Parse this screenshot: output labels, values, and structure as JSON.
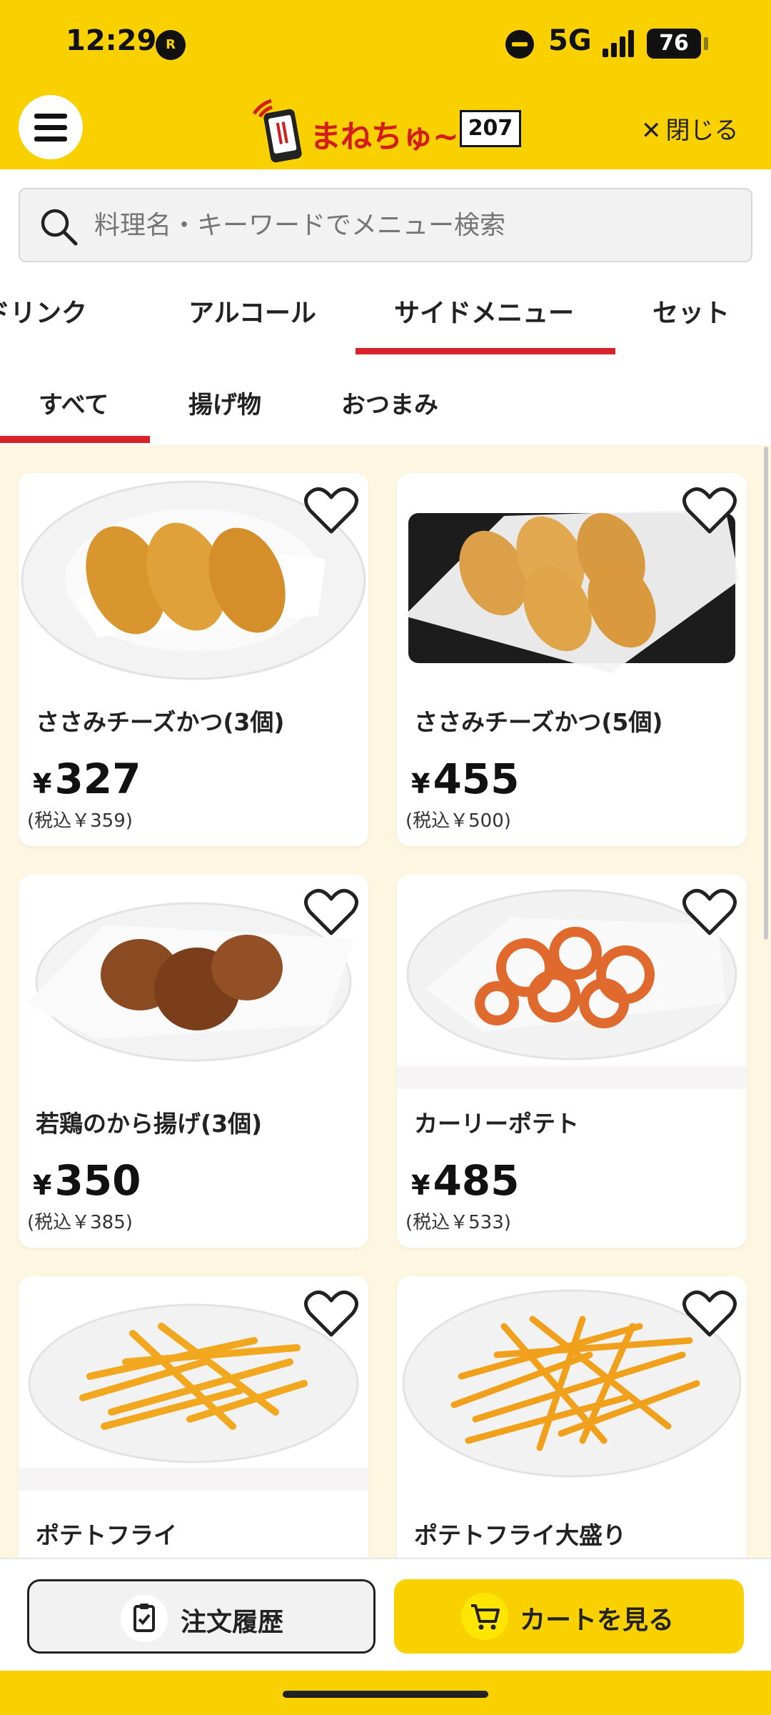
{
  "status_bar": {
    "time": "12:29",
    "r_badge": "R",
    "network": "5G",
    "battery": "76"
  },
  "header": {
    "logo_text": "まねちゅ~",
    "table_number": "207",
    "close_label": "閉じる"
  },
  "search": {
    "placeholder": "料理名・キーワードでメニュー検索"
  },
  "category_tabs": [
    {
      "label": "ドリンク"
    },
    {
      "label": "アルコール"
    },
    {
      "label": "サイドメニュー",
      "active": true
    },
    {
      "label": "セット"
    }
  ],
  "sub_tabs": [
    {
      "label": "すべて",
      "active": true
    },
    {
      "label": "揚げ物"
    },
    {
      "label": "おつまみ"
    }
  ],
  "items": [
    {
      "name": "ささみチーズかつ(3個)",
      "yen": "¥",
      "price": "327",
      "tax": "(税込￥359)"
    },
    {
      "name": "ささみチーズかつ(5個)",
      "yen": "¥",
      "price": "455",
      "tax": "(税込￥500)"
    },
    {
      "name": "若鶏のから揚げ(3個)",
      "yen": "¥",
      "price": "350",
      "tax": "(税込￥385)"
    },
    {
      "name": "カーリーポテト",
      "yen": "¥",
      "price": "485",
      "tax": "(税込￥533)"
    },
    {
      "name": "ポテトフライ"
    },
    {
      "name": "ポテトフライ大盛り"
    }
  ],
  "bottom": {
    "history_label": "注文履歴",
    "cart_label": "カートを見る"
  },
  "colors": {
    "brand_yellow": "#fad100",
    "accent_red": "#d8232a",
    "logo_red": "#d41c1c"
  }
}
